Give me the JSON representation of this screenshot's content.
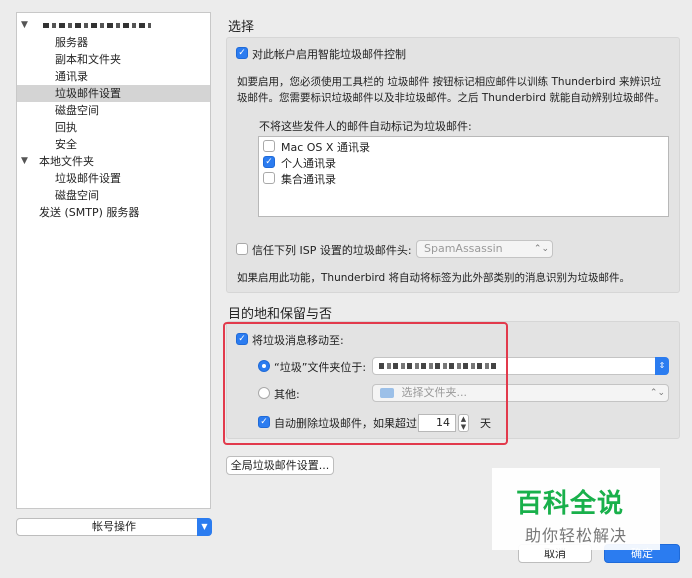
{
  "sidebar": {
    "account_name": "",
    "items": [
      {
        "label": "服务器"
      },
      {
        "label": "副本和文件夹"
      },
      {
        "label": "通讯录"
      },
      {
        "label": "垃圾邮件设置"
      },
      {
        "label": "磁盘空间"
      },
      {
        "label": "回执"
      },
      {
        "label": "安全"
      }
    ],
    "local_folders": {
      "label": "本地文件夹",
      "items": [
        {
          "label": "垃圾邮件设置"
        },
        {
          "label": "磁盘空间"
        }
      ]
    },
    "smtp": {
      "label": "发送 (SMTP) 服务器"
    },
    "account_actions": "帐号操作"
  },
  "selection": {
    "title": "选择",
    "enable_label": "对此帐户启用智能垃圾邮件控制",
    "enable_checked": true,
    "description_line1": "如要启用，您必须使用工具栏的 垃圾邮件 按钮标记相应邮件以训练 Thunderbird 来辨识垃",
    "description_line2": "圾邮件。您需要标识垃圾邮件以及非垃圾邮件。之后 Thunderbird 就能自动辨别垃圾邮件。",
    "whitelist_label": "不将这些发件人的邮件自动标记为垃圾邮件:",
    "whitelist": [
      {
        "label": "Mac OS X 通讯录",
        "checked": false
      },
      {
        "label": "个人通讯录",
        "checked": true
      },
      {
        "label": "集合通讯录",
        "checked": false
      }
    ],
    "isp_label": "信任下列 ISP 设置的垃圾邮件头:",
    "isp_checked": false,
    "isp_value": "SpamAssassin",
    "isp_note": "如果启用此功能，Thunderbird 将自动将标签为此外部类别的消息识别为垃圾邮件。"
  },
  "destination": {
    "title": "目的地和保留与否",
    "move_label": "将垃圾消息移动至:",
    "move_checked": true,
    "junk_folder_label": "“垃圾”文件夹位于:",
    "junk_folder_selected": true,
    "other_label": "其他:",
    "other_placeholder": "选择文件夹...",
    "auto_delete_label": "自动删除垃圾邮件，如果超过",
    "auto_delete_checked": true,
    "days_value": "14",
    "days_unit": "天"
  },
  "buttons": {
    "global_settings": "全局垃圾邮件设置...",
    "cancel": "取消",
    "ok": "确定"
  },
  "watermark": {
    "title": "百科全说",
    "subtitle": "助你轻松解决"
  },
  "colors": {
    "accent": "#2b7cf0",
    "highlight": "#e23a4c",
    "watermark_green": "#19b04b"
  }
}
